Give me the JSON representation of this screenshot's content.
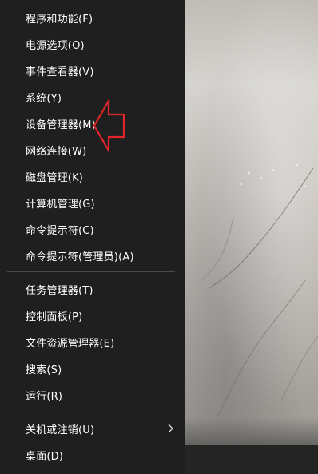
{
  "menu": {
    "group1": [
      {
        "id": "programs-features",
        "label": "程序和功能(F)"
      },
      {
        "id": "power-options",
        "label": "电源选项(O)"
      },
      {
        "id": "event-viewer",
        "label": "事件查看器(V)"
      },
      {
        "id": "system",
        "label": "系统(Y)"
      },
      {
        "id": "device-manager",
        "label": "设备管理器(M)"
      },
      {
        "id": "network-connections",
        "label": "网络连接(W)"
      },
      {
        "id": "disk-management",
        "label": "磁盘管理(K)"
      },
      {
        "id": "computer-management",
        "label": "计算机管理(G)"
      },
      {
        "id": "command-prompt",
        "label": "命令提示符(C)"
      },
      {
        "id": "command-prompt-admin",
        "label": "命令提示符(管理员)(A)"
      }
    ],
    "group2": [
      {
        "id": "task-manager",
        "label": "任务管理器(T)"
      },
      {
        "id": "control-panel",
        "label": "控制面板(P)"
      },
      {
        "id": "file-explorer",
        "label": "文件资源管理器(E)"
      },
      {
        "id": "search",
        "label": "搜索(S)"
      },
      {
        "id": "run",
        "label": "运行(R)"
      }
    ],
    "group3": [
      {
        "id": "shutdown-signout",
        "label": "关机或注销(U)",
        "has_submenu": true
      },
      {
        "id": "desktop",
        "label": "桌面(D)"
      }
    ]
  },
  "annotation": {
    "arrow_color": "#e0252b",
    "points_to": "device-manager"
  }
}
